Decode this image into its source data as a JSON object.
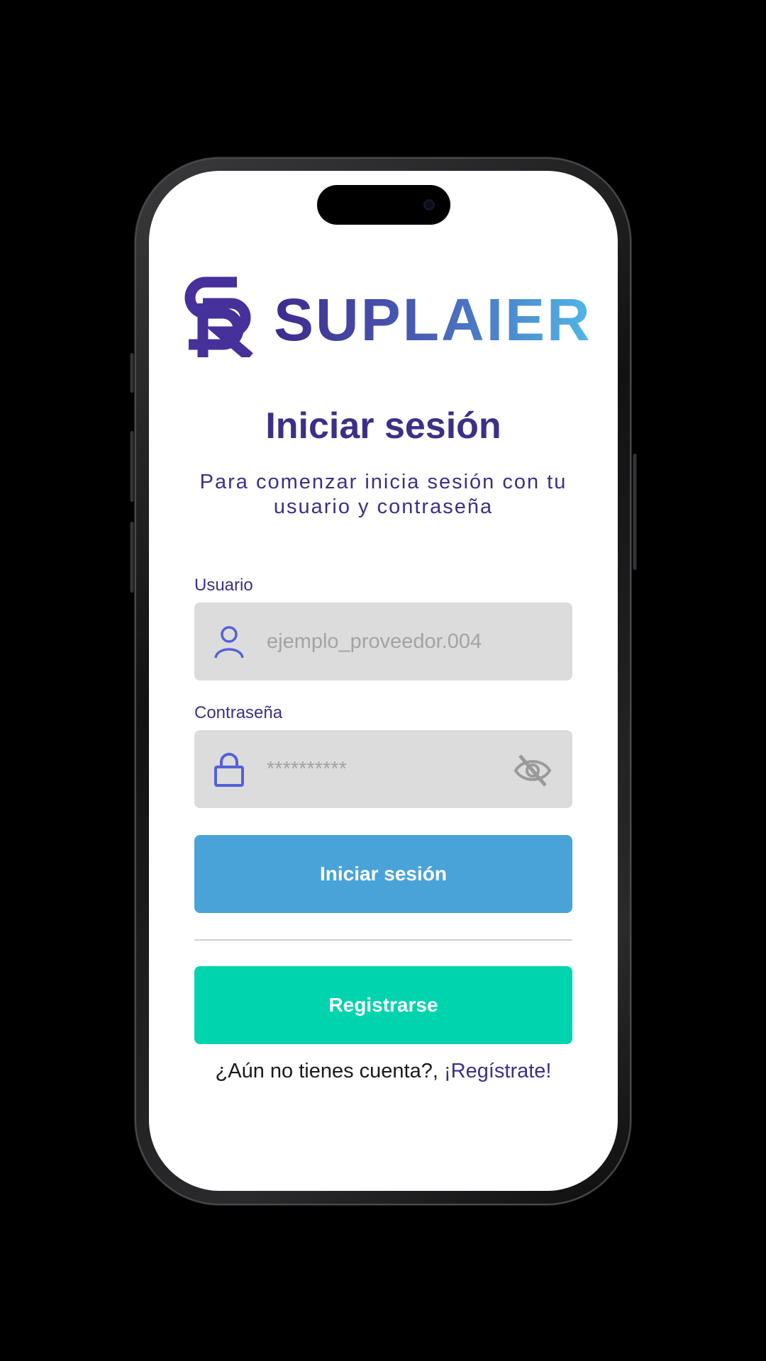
{
  "brand": {
    "name": "SUPLAIER",
    "logo_mark": "SR"
  },
  "login": {
    "title": "Iniciar sesión",
    "subtitle": "Para comenzar inicia sesión con tu usuario y contraseña",
    "username": {
      "label": "Usuario",
      "placeholder": "ejemplo_proveedor.004",
      "icon": "user-icon"
    },
    "password": {
      "label": "Contraseña",
      "placeholder": "**********",
      "icon": "lock-icon",
      "toggle_icon": "eye-off-icon"
    },
    "submit_label": "Iniciar sesión",
    "register_label": "Registrarse",
    "no_account_text": "¿Aún no tienes cuenta?,",
    "register_link": "¡Regístrate!"
  },
  "colors": {
    "primary": "#3d2f86",
    "submit_button": "#4aa3d8",
    "register_button": "#00d4ae",
    "input_bg": "#dcdcdc"
  }
}
